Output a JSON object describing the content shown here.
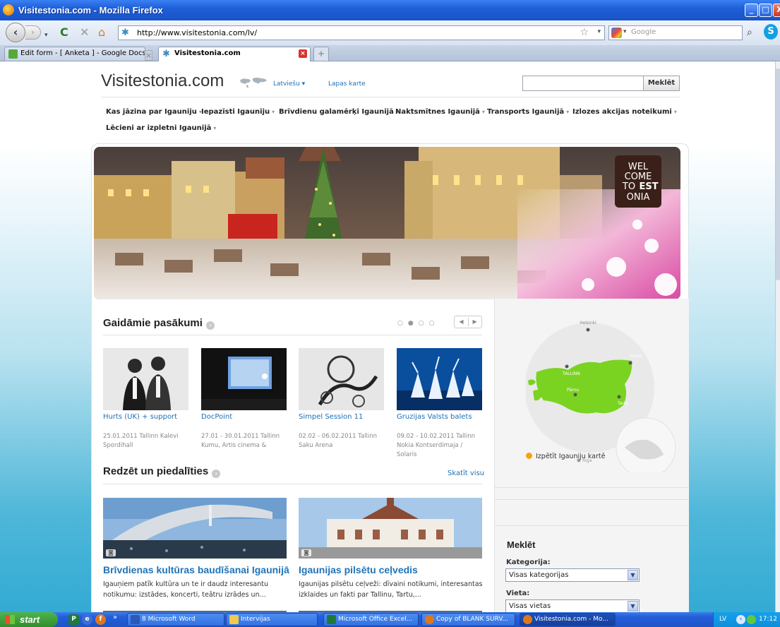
{
  "window": {
    "title": "Visitestonia.com - Mozilla Firefox",
    "min": "_",
    "max": "□",
    "close": "X"
  },
  "navbar": {
    "url": "http://www.visitestonia.com/lv/",
    "search_placeholder": "Google"
  },
  "tabs": [
    {
      "label": "Edit form - [ Anketa ] - Google Docs"
    },
    {
      "label": "Visitestonia.com"
    }
  ],
  "site": {
    "logo": "Visitestonia.com",
    "language": "Latviešu ▾",
    "sitemap": "Lapas karte",
    "search_button": "Meklēt",
    "nav": [
      "Kas jāzina par Igauniju",
      "Iepazīsti Igauniju",
      "Brīvdienu galamērķi Igaunijā",
      "Naktsmītnes Igaunijā",
      "Transports Igaunijā",
      "Izlozes akcijas noteikumi",
      "Lēcieni ar izpletni Igaunijā"
    ],
    "hero_badge": [
      "WEL",
      "COME",
      "TO",
      "EST",
      "ONIA"
    ]
  },
  "events": {
    "title": "Gaidāmie pasākumi",
    "items": [
      {
        "title": "Hurts (UK) + support",
        "info": "25.01.2011 Tallinn Kalevi Spordihall"
      },
      {
        "title": "DocPoint",
        "info": "27.01 - 30.01.2011 Tallinn Kumu, Artis cinema &"
      },
      {
        "title": "Simpel Session 11",
        "info": "02.02 - 06.02.2011 Tallinn Saku Arena"
      },
      {
        "title": "Gruzijas Valsts balets",
        "info": "09.02 - 10.02.2011 Tallinn Nokia Kontserdimaja / Solaris"
      }
    ]
  },
  "map": {
    "cities": [
      "Helsinki",
      "TALLINN",
      "Narva",
      "Pärnu",
      "Tartu",
      "Riga"
    ],
    "link": "Izpētīt Igauniju kartē"
  },
  "featured": {
    "title": "Redzēt un piedalīties",
    "see_all": "Skatīt visu",
    "items": [
      {
        "title": "Brīvdienas kultūras baudīšanai Igaunijā",
        "desc": "Igauņiem patīk kultūra un te ir daudz interesantu notikumu: izstādes, koncerti, teātru izrādes un..."
      },
      {
        "title": "Igaunijas pilsētu ceļvedis",
        "desc": "Igaunijas pilsētu ceļveži: dīvaini notikumi, interesantas izklaides un fakti par Tallinu, Tartu,..."
      }
    ]
  },
  "sidebar_search": {
    "title": "Meklēt",
    "category_label": "Kategorija:",
    "category_value": "Visas kategorijas",
    "place_label": "Vieta:",
    "place_value": "Visas vietas"
  },
  "taskbar": {
    "start": "start",
    "tasks": [
      "8 Microsoft Word",
      "Intervijas",
      "Microsoft Office Excel...",
      "Copy of BLANK SURV...",
      "Visitestonia.com - Mo..."
    ],
    "lang": "LV",
    "time": "17:12"
  },
  "colors": {
    "link": "#1d6fb7",
    "accent_orange": "#f4a40f",
    "map_green": "#7bd321",
    "xp_blue": "#245edb"
  }
}
